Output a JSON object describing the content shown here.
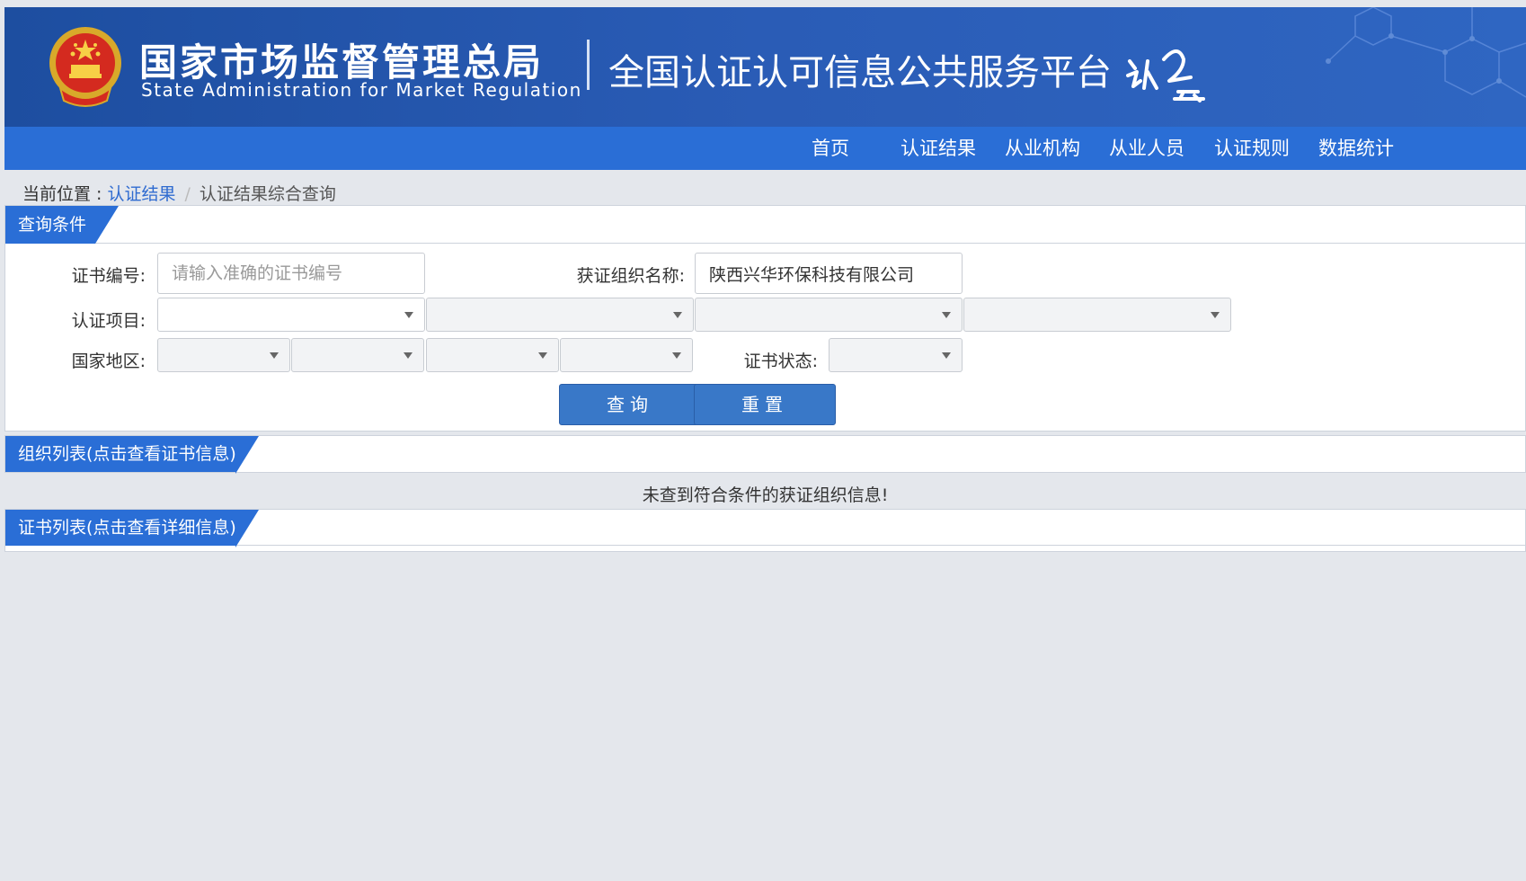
{
  "header": {
    "agency_cn": "国家市场监督管理总局",
    "agency_en": "State Administration  for  Market Regulation",
    "platform_title": "全国认证认可信息公共服务平台",
    "emblem_icon": "national-emblem-icon",
    "logo_icon": "renzheng-yun-logo-icon",
    "colors": {
      "header_bg": "#1d4ea0",
      "nav_bg": "#2a6ed6",
      "accent": "#2f6bd0"
    }
  },
  "nav": {
    "items": [
      {
        "label": "首页"
      },
      {
        "label": "认证结果"
      },
      {
        "label": "从业机构"
      },
      {
        "label": "从业人员"
      },
      {
        "label": "认证规则"
      },
      {
        "label": "数据统计"
      }
    ]
  },
  "breadcrumb": {
    "label": "当前位置 : ",
    "link": "认证结果",
    "separator": "/",
    "current": "认证结果综合查询"
  },
  "query": {
    "title": "查询条件",
    "cert_no_label": "证书编号:",
    "cert_no_placeholder": "请输入准确的证书编号",
    "cert_no_value": "",
    "org_name_label": "获证组织名称:",
    "org_name_value": "陕西兴华环保科技有限公司",
    "project_label": "认证项目:",
    "region_label": "国家地区:",
    "status_label": "证书状态:",
    "search_button": "查询",
    "reset_button": "重置"
  },
  "org_list": {
    "title": "组织列表(点击查看证书信息)",
    "empty_message": "未查到符合条件的获证组织信息!"
  },
  "cert_list": {
    "title": "证书列表(点击查看详细信息)"
  }
}
